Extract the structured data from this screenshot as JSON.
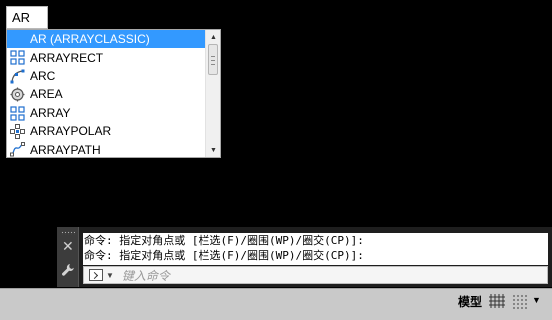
{
  "command_input": {
    "value": "AR"
  },
  "autocomplete": {
    "items": [
      {
        "label": "AR (ARRAYCLASSIC)",
        "icon": "none",
        "selected": true
      },
      {
        "label": "ARRAYRECT",
        "icon": "array-rect-icon",
        "selected": false
      },
      {
        "label": "ARC",
        "icon": "arc-icon",
        "selected": false
      },
      {
        "label": "AREA",
        "icon": "area-icon",
        "selected": false
      },
      {
        "label": "ARRAY",
        "icon": "array-icon",
        "selected": false
      },
      {
        "label": "ARRAYPOLAR",
        "icon": "array-polar-icon",
        "selected": false
      },
      {
        "label": "ARRAYPATH",
        "icon": "array-path-icon",
        "selected": false
      }
    ],
    "scroll_up_glyph": "▲",
    "scroll_down_glyph": "▼"
  },
  "command_window": {
    "close_glyph": "✕",
    "history": [
      "命令: 指定对角点或 [栏选(F)/圈围(WP)/圈交(CP)]:",
      "命令: 指定对角点或 [栏选(F)/圈围(WP)/圈交(CP)]:"
    ],
    "prompt_caret": "▼",
    "prompt_placeholder": "键入命令"
  },
  "status_bar": {
    "model_label": "模型",
    "menu_glyph": "▼"
  },
  "colors": {
    "selected_bg": "#3399ff",
    "icon_blue": "#1e6fcf",
    "canvas": "#000000",
    "status_bar": "#c9c9c9"
  }
}
